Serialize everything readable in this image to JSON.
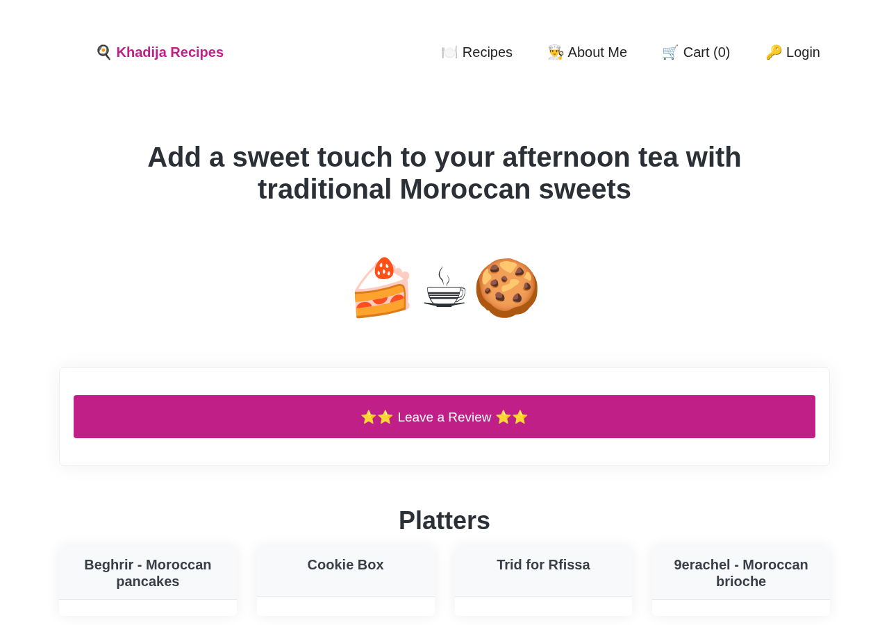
{
  "nav": {
    "brand": "🍳 Khadija Recipes",
    "links": [
      {
        "label": "🍽️ Recipes"
      },
      {
        "label": "👨‍🍳 About Me"
      },
      {
        "label": "🛒 Cart (0)"
      },
      {
        "label": "🔑 Login"
      }
    ]
  },
  "hero": {
    "title": "Add a sweet touch to your afternoon tea with traditional Moroccan sweets",
    "emojis": [
      "🍰",
      "☕",
      "🍪"
    ]
  },
  "review": {
    "button": "⭐⭐ Leave a Review ⭐⭐"
  },
  "platters": {
    "title": "Platters",
    "items": [
      {
        "name": "Beghrir - Moroccan pancakes"
      },
      {
        "name": "Cookie Box"
      },
      {
        "name": "Trid for Rfissa"
      },
      {
        "name": "9erachel - Moroccan brioche"
      }
    ]
  }
}
